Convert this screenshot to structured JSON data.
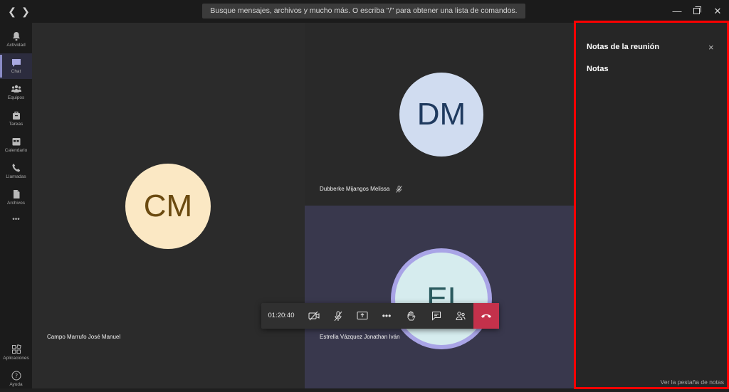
{
  "titlebar": {
    "search_text": "Busque mensajes, archivos y mucho más. O escriba \"/\" para obtener una lista de comandos.",
    "back_icon": "chevron-left-icon",
    "forward_icon": "chevron-right-icon"
  },
  "rail": {
    "items": [
      {
        "label": "Actividad",
        "icon": "bell-icon"
      },
      {
        "label": "Chat",
        "icon": "chat-icon"
      },
      {
        "label": "Equipos",
        "icon": "teams-icon"
      },
      {
        "label": "Tareas",
        "icon": "bag-icon"
      },
      {
        "label": "Calendario",
        "icon": "calendar-icon"
      },
      {
        "label": "Llamadas",
        "icon": "phone-icon"
      },
      {
        "label": "Archivos",
        "icon": "file-icon"
      },
      {
        "label": "Aplicaciones",
        "icon": "apps-icon"
      },
      {
        "label": "Ayuda",
        "icon": "help-icon"
      }
    ],
    "more_label": "•••"
  },
  "participants": [
    {
      "initials": "CM",
      "name": "Campo Marrufo José Manuel"
    },
    {
      "initials": "DM",
      "name": "Dubberke Mijangos Melissa"
    },
    {
      "initials": "EI",
      "name": "Estrella Vázquez Jonathan Iván"
    }
  ],
  "controls": {
    "timer": "01:20:40",
    "more_label": "•••"
  },
  "notes": {
    "title": "Notas de la reunión",
    "close_label": "×",
    "heading": "Notas",
    "link": "Ver la pestaña de notas"
  },
  "colors": {
    "accent": "#8b8cc7",
    "hangup": "#c4314b",
    "highlight_border": "#ff0000"
  }
}
